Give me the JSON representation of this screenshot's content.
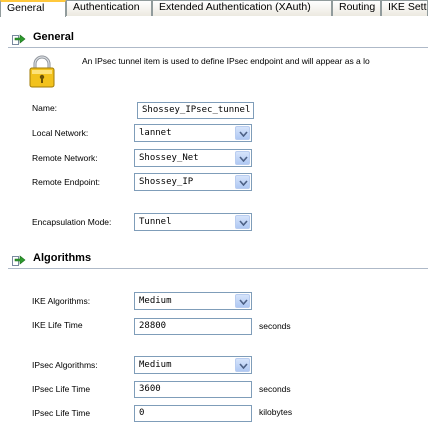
{
  "tabs": [
    {
      "label": "General",
      "active": true
    },
    {
      "label": "Authentication",
      "active": false
    },
    {
      "label": "Extended Authentication (XAuth)",
      "active": false
    },
    {
      "label": "Routing",
      "active": false
    },
    {
      "label": "IKE Setti",
      "active": false
    }
  ],
  "general": {
    "title": "General",
    "description": "An IPsec tunnel item is used to define IPsec endpoint and will appear as a lo",
    "name": {
      "label": "Name:",
      "value": "Shossey_IPsec_tunnel"
    },
    "local_network": {
      "label": "Local Network:",
      "value": "lannet"
    },
    "remote_network": {
      "label": "Remote Network:",
      "value": "Shossey_Net"
    },
    "remote_endpoint": {
      "label": "Remote Endpoint:",
      "value": "Shossey_IP"
    },
    "encapsulation_mode": {
      "label": "Encapsulation Mode:",
      "value": "Tunnel"
    }
  },
  "algorithms": {
    "title": "Algorithms",
    "ike_algorithms": {
      "label": "IKE Algorithms:",
      "value": "Medium"
    },
    "ike_life_time": {
      "label": "IKE Life Time",
      "value": "28800",
      "unit": "seconds"
    },
    "ipsec_algorithms": {
      "label": "IPsec Algorithms:",
      "value": "Medium"
    },
    "ipsec_life_time": {
      "label": "IPsec Life Time",
      "value": "3600",
      "unit": "seconds"
    },
    "ipsec_life_time_kb": {
      "label": "IPsec Life Time",
      "value": "0",
      "unit": "kilobytes"
    }
  },
  "icons": {
    "section": "green-arrow-icon",
    "lock": "padlock-icon",
    "dropdown": "chevron-down-icon"
  },
  "colors": {
    "active_tab_accent": "#ffc83c",
    "field_border": "#7f9db9",
    "dropdown_button": "#c3d6f7",
    "section_arrow": "#2e9b2e"
  }
}
